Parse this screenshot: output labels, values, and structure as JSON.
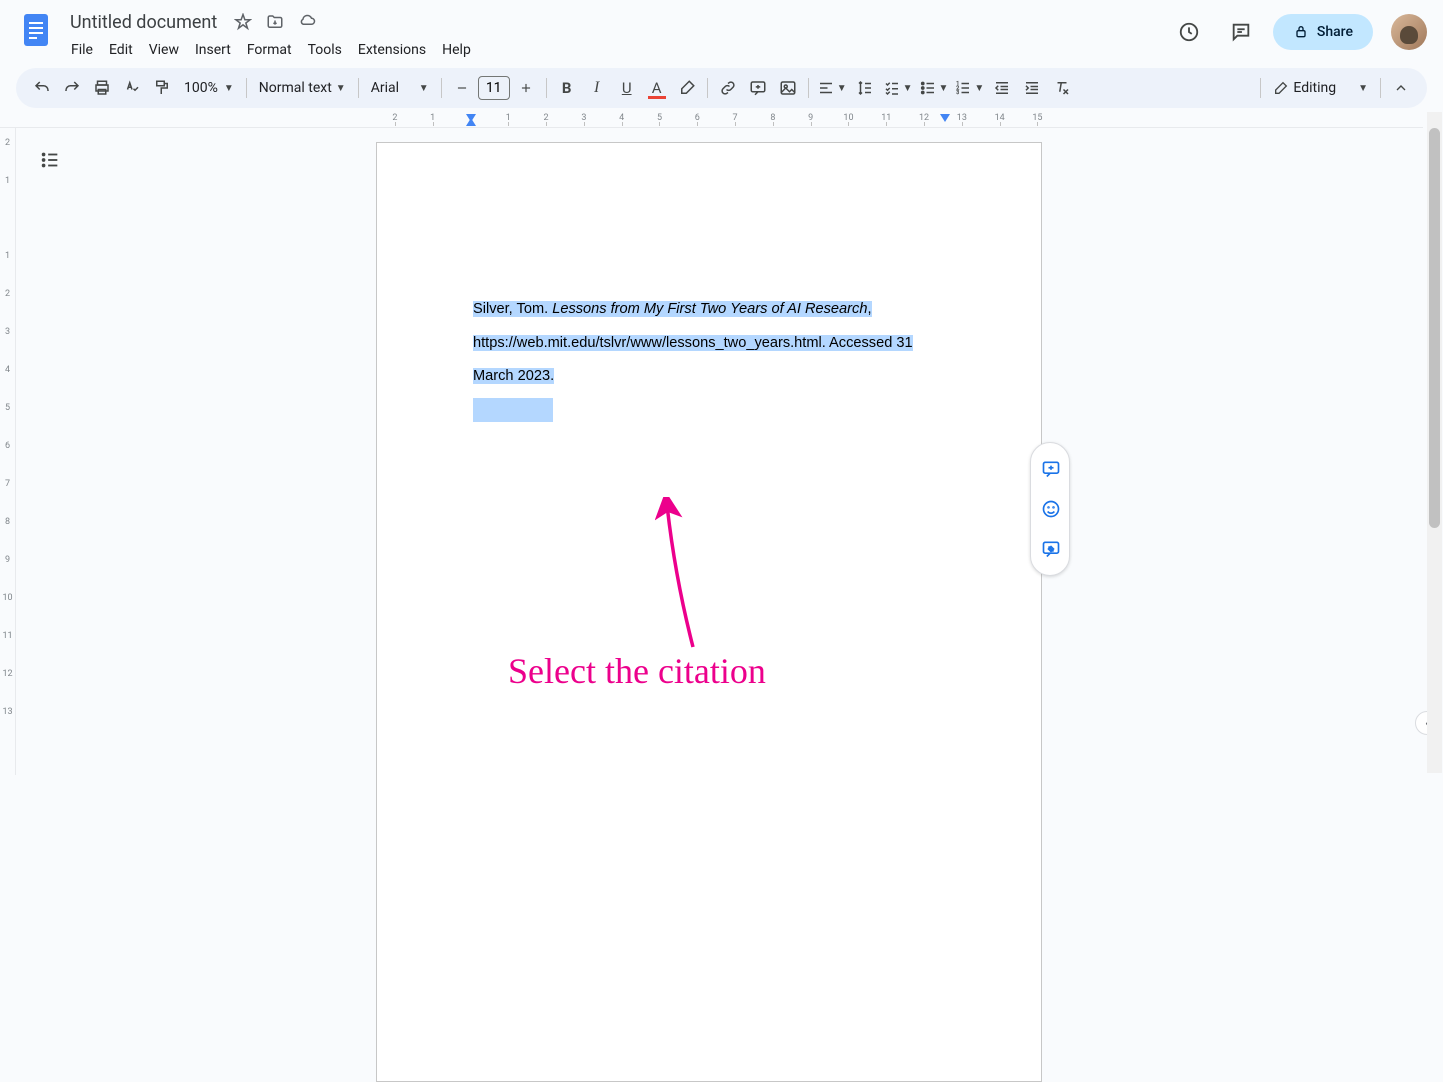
{
  "header": {
    "doc_title": "Untitled document",
    "menus": [
      "File",
      "Edit",
      "View",
      "Insert",
      "Format",
      "Tools",
      "Extensions",
      "Help"
    ],
    "share_label": "Share"
  },
  "toolbar": {
    "zoom": "100%",
    "style": "Normal text",
    "font": "Arial",
    "font_size": "11",
    "mode": "Editing"
  },
  "document": {
    "citation_author": "Silver, Tom. ",
    "citation_title": "Lessons from My First Two Years of AI Research",
    "citation_rest1": ", https://web.mit.edu/tslvr/www/lessons_two_years.html. Accessed 31 ",
    "citation_rest2": "March 2023."
  },
  "annotation": {
    "text": "Select the citation"
  },
  "ruler": {
    "h_ticks": [
      "2",
      "1",
      "",
      "1",
      "2",
      "3",
      "4",
      "5",
      "6",
      "7",
      "8",
      "9",
      "10",
      "11",
      "12",
      "13",
      "14",
      "15"
    ],
    "v_ticks": [
      "2",
      "1",
      "",
      "1",
      "2",
      "3",
      "4",
      "5",
      "6",
      "7",
      "8",
      "9",
      "10",
      "11",
      "12",
      "13"
    ]
  }
}
